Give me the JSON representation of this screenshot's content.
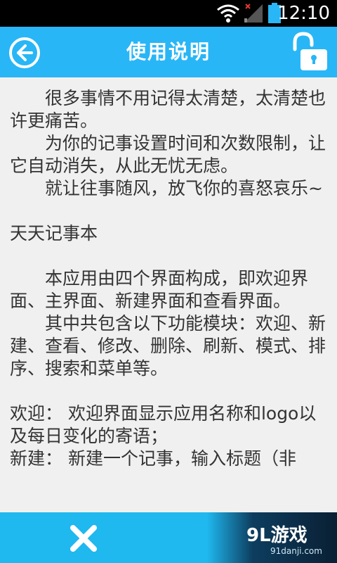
{
  "status_bar": {
    "time": "12:10",
    "icons": [
      "wifi-icon",
      "signal-icon",
      "battery-icon"
    ]
  },
  "header": {
    "title": "使用说明",
    "back_icon": "back-arrow-icon",
    "lock_icon": "unlock-icon",
    "color": "#29b6f6"
  },
  "content": {
    "paragraphs": [
      {
        "type": "indent",
        "text": "很多事情不用记得太清楚，太清楚也许更痛苦。"
      },
      {
        "type": "indent",
        "text": "为你的记事设置时间和次数限制，让它自动消失，从此无忧无虑。"
      },
      {
        "type": "indent",
        "text": "就让往事随风，放飞你的喜怒哀乐~"
      },
      {
        "type": "gap",
        "text": ""
      },
      {
        "type": "plain",
        "text": "天天记事本"
      },
      {
        "type": "gap",
        "text": ""
      },
      {
        "type": "indent",
        "text": "本应用由四个界面构成，即欢迎界面、主界面、新建界面和查看界面。"
      },
      {
        "type": "indent",
        "text": "其中共包含以下功能模块：欢迎、新建、查看、修改、删除、刷新、模式、排序、搜索和菜单等。"
      },
      {
        "type": "gap",
        "text": ""
      },
      {
        "type": "plain",
        "text": "欢迎：  欢迎界面显示应用名称和logo以及每日变化的寄语；"
      },
      {
        "type": "plain",
        "text": "新建：  新建一个记事，输入标题（非"
      }
    ]
  },
  "bottom_bar": {
    "close_icon": "close-icon",
    "watermark": {
      "logo": "9L游戏",
      "url": "91danji.com"
    }
  }
}
